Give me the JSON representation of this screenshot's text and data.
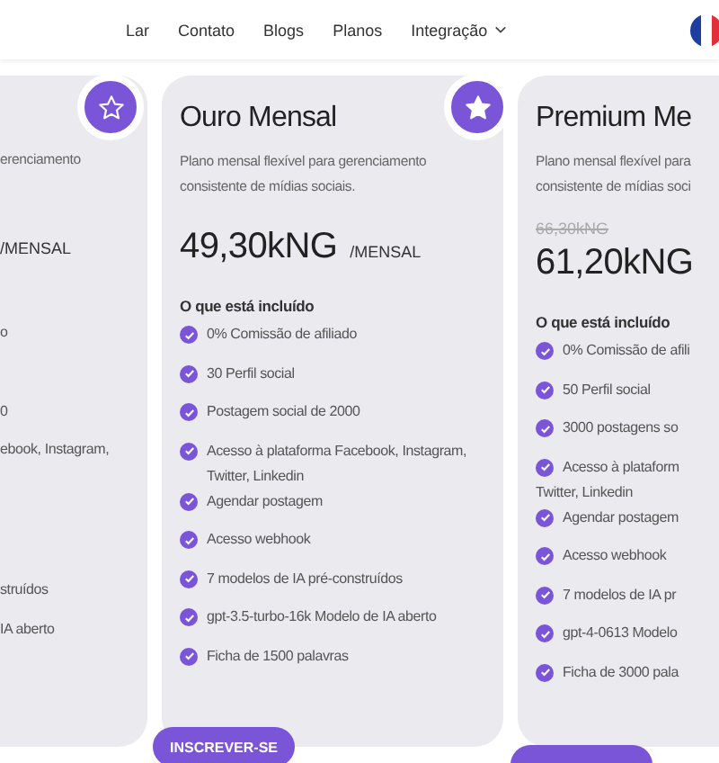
{
  "nav": {
    "links": [
      {
        "label": "Lar"
      },
      {
        "label": "Contato"
      },
      {
        "label": "Blogs"
      },
      {
        "label": "Planos"
      },
      {
        "label": "Integração",
        "dropdown": true
      }
    ]
  },
  "plans": [
    {
      "kind": "cut",
      "selected": false,
      "description": "erenciamento",
      "period": "/MENSAL",
      "features": [
        "o",
        "0",
        "ebook, Instagram,",
        "struídos",
        "IA aberto"
      ]
    },
    {
      "kind": "full",
      "selected": true,
      "title": "Ouro Mensal",
      "description": "Plano mensal flexível para gerenciamento consistente de mídias sociais.",
      "price": "49,30kNG",
      "period": "/MENSAL",
      "included_heading": "O que está incluído",
      "features": [
        "0% Comissão de afiliado",
        "30 Perfil social",
        "Postagem social de 2000",
        "Acesso à plataforma Facebook, Instagram, Twitter, Linkedin",
        "Agendar postagem",
        "Acesso webhook",
        "7 modelos de IA pré-construídos",
        "gpt-3.5-turbo-16k Modelo de IA aberto",
        "Ficha de 1500 palavras"
      ],
      "button": "INSCREVER-SE"
    },
    {
      "kind": "edge",
      "title": "Premium Me",
      "description_lines": [
        "Plano mensal flexível para",
        "consistente de mídias soci"
      ],
      "old_price": "66,30kNG",
      "price": "61,20kNG",
      "included_heading": "O que está incluído",
      "features": [
        "0% Comissão de afili",
        "50 Perfil social",
        "3000 postagens so",
        "Acesso à plataform",
        "Agendar postagem",
        "Acesso webhook",
        "7 modelos de IA pr",
        "gpt-4-0613 Modelo",
        "Ficha de 3000 pala"
      ],
      "feature_continuations": {
        "3": "Twitter, Linkedin"
      }
    }
  ]
}
